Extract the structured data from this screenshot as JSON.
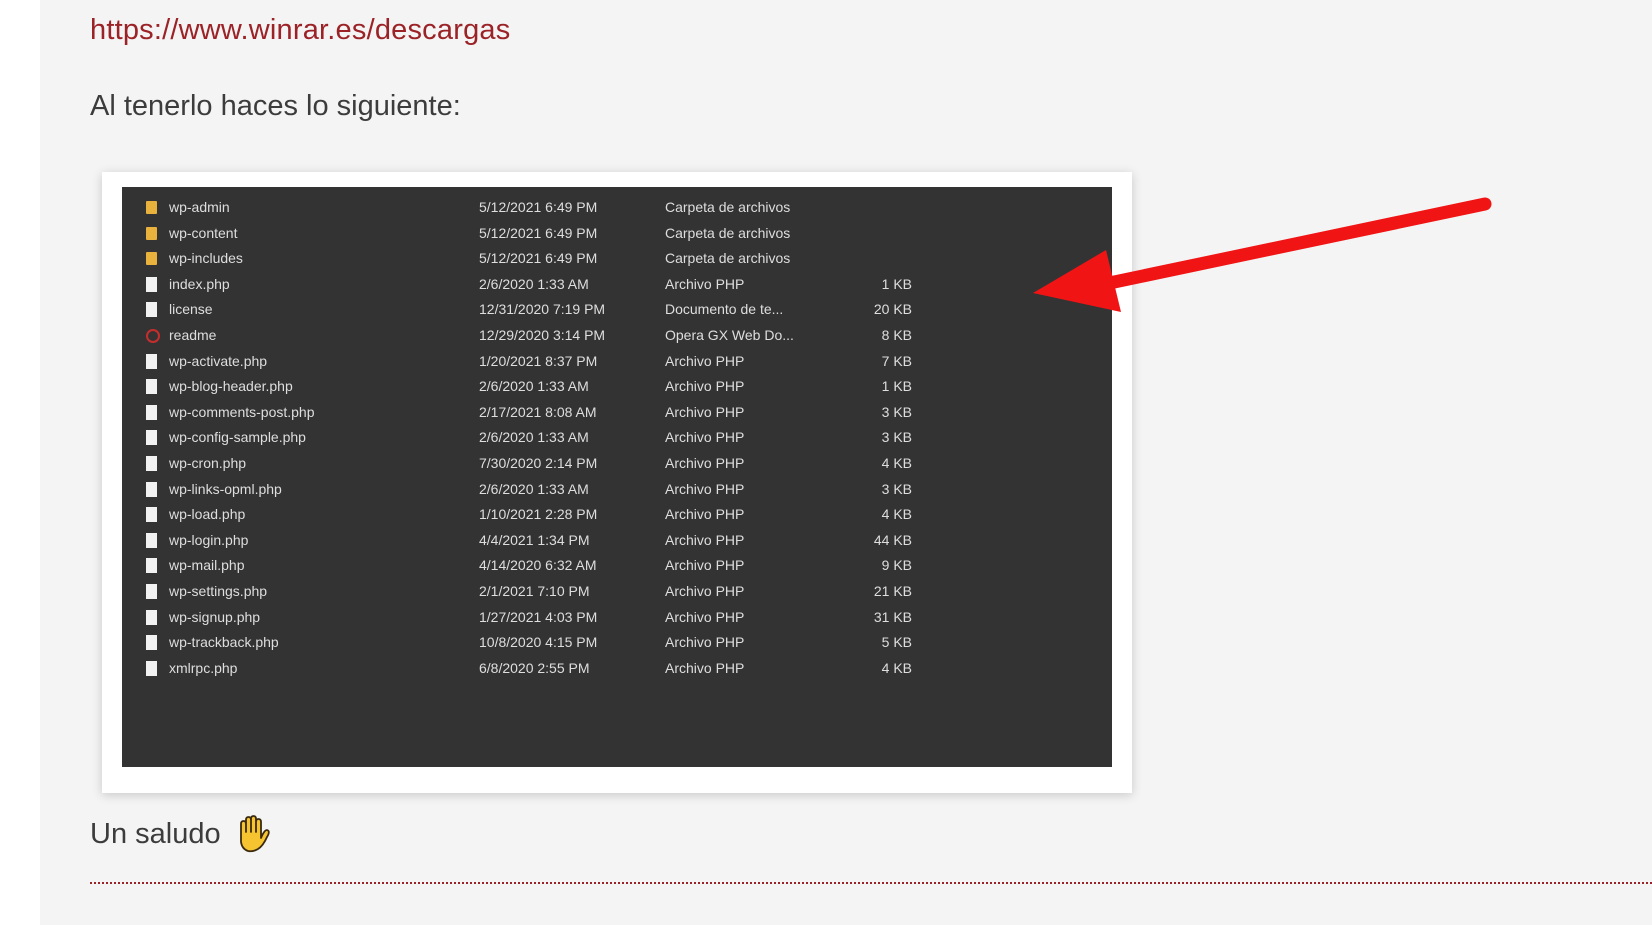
{
  "post": {
    "link_text": "https://www.winrar.es/descargas",
    "instruction": "Al tenerlo haces lo siguiente:",
    "greeting": "Un saludo",
    "bottom_partial": "—— ——— ——— —— — ————— ——— —"
  },
  "explorer": {
    "files": [
      {
        "icon": "folder",
        "name": "wp-admin",
        "date": "5/12/2021 6:49 PM",
        "type": "Carpeta de archivos",
        "size": ""
      },
      {
        "icon": "folder",
        "name": "wp-content",
        "date": "5/12/2021 6:49 PM",
        "type": "Carpeta de archivos",
        "size": ""
      },
      {
        "icon": "folder",
        "name": "wp-includes",
        "date": "5/12/2021 6:49 PM",
        "type": "Carpeta de archivos",
        "size": ""
      },
      {
        "icon": "file",
        "name": "index.php",
        "date": "2/6/2020 1:33 AM",
        "type": "Archivo PHP",
        "size": "1 KB"
      },
      {
        "icon": "file",
        "name": "license",
        "date": "12/31/2020 7:19 PM",
        "type": "Documento de te...",
        "size": "20 KB"
      },
      {
        "icon": "opera",
        "name": "readme",
        "date": "12/29/2020 3:14 PM",
        "type": "Opera GX Web Do...",
        "size": "8 KB"
      },
      {
        "icon": "file",
        "name": "wp-activate.php",
        "date": "1/20/2021 8:37 PM",
        "type": "Archivo PHP",
        "size": "7 KB"
      },
      {
        "icon": "file",
        "name": "wp-blog-header.php",
        "date": "2/6/2020 1:33 AM",
        "type": "Archivo PHP",
        "size": "1 KB"
      },
      {
        "icon": "file",
        "name": "wp-comments-post.php",
        "date": "2/17/2021 8:08 AM",
        "type": "Archivo PHP",
        "size": "3 KB"
      },
      {
        "icon": "file",
        "name": "wp-config-sample.php",
        "date": "2/6/2020 1:33 AM",
        "type": "Archivo PHP",
        "size": "3 KB"
      },
      {
        "icon": "file",
        "name": "wp-cron.php",
        "date": "7/30/2020 2:14 PM",
        "type": "Archivo PHP",
        "size": "4 KB"
      },
      {
        "icon": "file",
        "name": "wp-links-opml.php",
        "date": "2/6/2020 1:33 AM",
        "type": "Archivo PHP",
        "size": "3 KB"
      },
      {
        "icon": "file",
        "name": "wp-load.php",
        "date": "1/10/2021 2:28 PM",
        "type": "Archivo PHP",
        "size": "4 KB"
      },
      {
        "icon": "file",
        "name": "wp-login.php",
        "date": "4/4/2021 1:34 PM",
        "type": "Archivo PHP",
        "size": "44 KB"
      },
      {
        "icon": "file",
        "name": "wp-mail.php",
        "date": "4/14/2020 6:32 AM",
        "type": "Archivo PHP",
        "size": "9 KB"
      },
      {
        "icon": "file",
        "name": "wp-settings.php",
        "date": "2/1/2021 7:10 PM",
        "type": "Archivo PHP",
        "size": "21 KB"
      },
      {
        "icon": "file",
        "name": "wp-signup.php",
        "date": "1/27/2021 4:03 PM",
        "type": "Archivo PHP",
        "size": "31 KB"
      },
      {
        "icon": "file",
        "name": "wp-trackback.php",
        "date": "10/8/2020 4:15 PM",
        "type": "Archivo PHP",
        "size": "5 KB"
      },
      {
        "icon": "file",
        "name": "xmlrpc.php",
        "date": "6/8/2020 2:55 PM",
        "type": "Archivo PHP",
        "size": "4 KB"
      }
    ]
  },
  "colors": {
    "link": "#9b2226",
    "arrow": "#f01414",
    "explorer_bg": "#333333",
    "folder": "#e8b23c"
  },
  "icons": {
    "arrow": "red-arrow-icon",
    "hand": "raised-hand-icon"
  }
}
